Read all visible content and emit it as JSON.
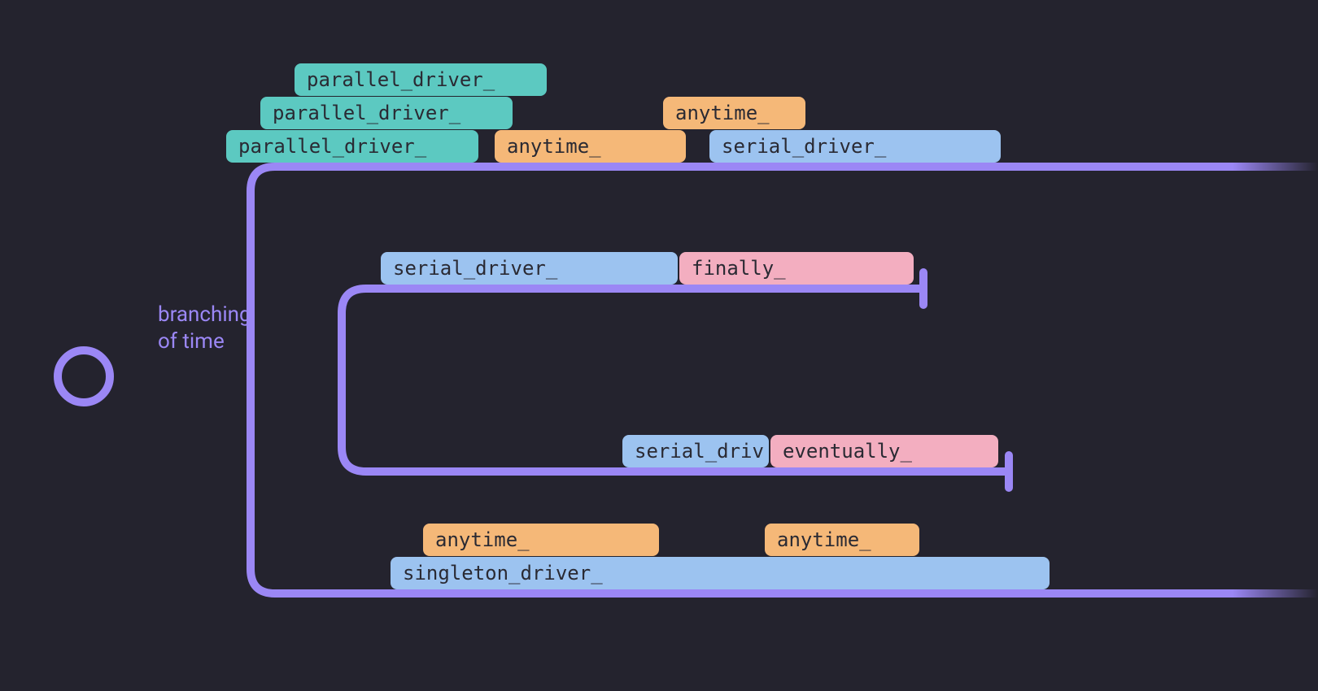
{
  "caption": {
    "line1": "branching",
    "line2": "of time"
  },
  "colors": {
    "bg": "#24232e",
    "branch": "#9b87f5",
    "teal": "#5cc9c1",
    "blue": "#9cc3f0",
    "orange": "#f5b878",
    "pink": "#f3aec0",
    "text": "#2a2a33"
  },
  "tags": {
    "pd1": "parallel_driver_",
    "pd2": "parallel_driver_",
    "pd3": "parallel_driver_",
    "any_top1": "anytime_",
    "any_top2": "anytime_",
    "sd_top": "serial_driver_",
    "sd_mid": "serial_driver_",
    "finally": "finally_",
    "sd_trunc": "serial_driv",
    "eventually": "eventually_",
    "any_bot1": "anytime_",
    "any_bot2": "anytime_",
    "singleton": "singleton_driver_"
  }
}
